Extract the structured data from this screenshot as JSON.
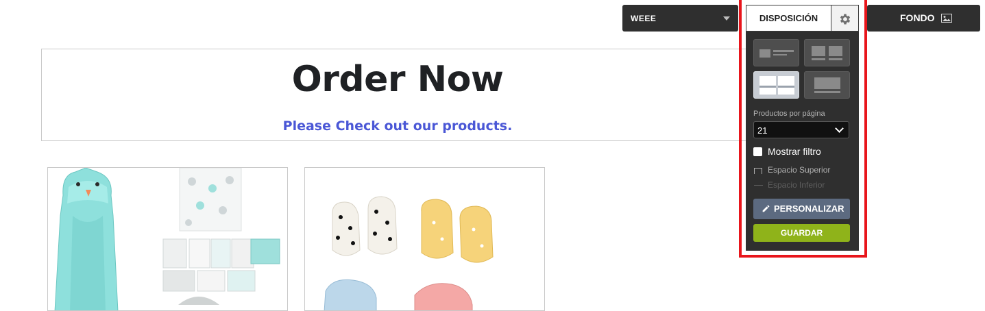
{
  "hero": {
    "title": "Order Now",
    "subtitle": "Please Check out our products."
  },
  "topbar": {
    "theme_select_value": "WEEE",
    "background_button_label": "FONDO",
    "background_icon": "image-icon"
  },
  "layout_panel": {
    "tab_label": "DISPOSICIÓN",
    "settings_icon": "gear-icon",
    "layout_options": [
      {
        "name": "list-layout",
        "active": false
      },
      {
        "name": "two-column-compact-layout",
        "active": false
      },
      {
        "name": "two-column-layout",
        "active": true
      },
      {
        "name": "single-column-layout",
        "active": false
      }
    ],
    "products_per_page_label": "Productos por página",
    "products_per_page_value": "21",
    "show_filter_label": "Mostrar filtro",
    "top_spacing_label": "Espacio Superior",
    "bottom_spacing_label": "Espacio Inferior",
    "customize_button_label": "PERSONALIZAR",
    "save_button_label": "GUARDAR"
  },
  "colors": {
    "highlight": "#e8151b",
    "subtitle": "#4a57d6",
    "save_button": "#8fb31a",
    "customize_button": "#5c6a80",
    "panel_bg": "#2f2f2f"
  },
  "products": [
    {
      "image": "baby-hooded-towel-and-washcloths"
    },
    {
      "image": "baby-mittens-set"
    }
  ]
}
